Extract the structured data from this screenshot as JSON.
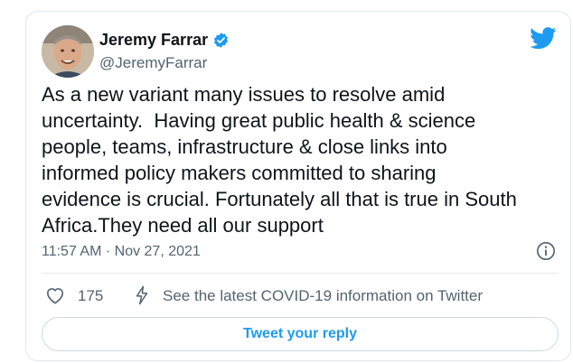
{
  "user": {
    "display_name": "Jeremy Farrar",
    "handle": "@JeremyFarrar"
  },
  "tweet": {
    "text": "As a new variant many issues to resolve amid\nuncertainty.  Having great public health & science\npeople, teams, infrastructure & close links into\ninformed policy makers committed to sharing\nevidence is crucial. Fortunately all that is true in South\nAfrica.They need all our support",
    "timestamp": "11:57 AM · Nov 27, 2021"
  },
  "actions": {
    "like_count": "175",
    "covid_info_label": "See the latest COVID-19 information on Twitter"
  },
  "reply": {
    "button_label": "Tweet your reply"
  },
  "colors": {
    "accent": "#1d9bf0",
    "text_primary": "#0f1419",
    "text_secondary": "#536471",
    "border": "#e1e8ed"
  },
  "icons": [
    "verified-badge-icon",
    "twitter-bird-icon",
    "info-icon",
    "heart-icon",
    "lightning-bolt-icon"
  ]
}
